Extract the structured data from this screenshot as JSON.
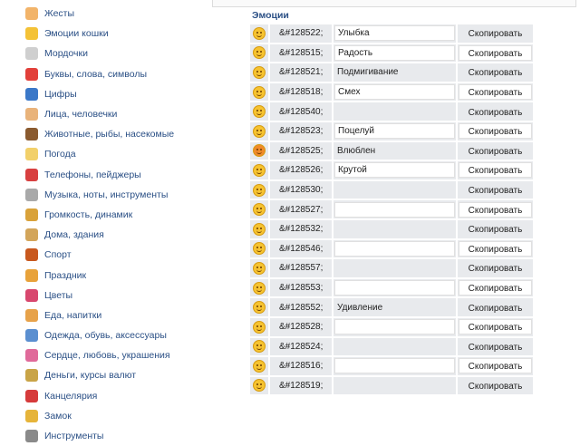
{
  "sidebar": {
    "items": [
      {
        "label": "Жесты",
        "icon": "thumbs-up-icon",
        "color": "#f2b46a"
      },
      {
        "label": "Эмоции кошки",
        "icon": "cat-face-icon",
        "color": "#f4c237"
      },
      {
        "label": "Мордочки",
        "icon": "animal-face-icon",
        "color": "#cfcfcf"
      },
      {
        "label": "Буквы, слова, символы",
        "icon": "letter-a-icon",
        "color": "#e2403a"
      },
      {
        "label": "Цифры",
        "icon": "digit-one-icon",
        "color": "#3b78c8"
      },
      {
        "label": "Лица, человечки",
        "icon": "person-face-icon",
        "color": "#e9b37a"
      },
      {
        "label": "Животные, рыбы, насекомые",
        "icon": "monkey-icon",
        "color": "#8a5a2f"
      },
      {
        "label": "Погода",
        "icon": "sun-cloud-icon",
        "color": "#f2d06a"
      },
      {
        "label": "Телефоны, пейджеры",
        "icon": "phone-icon",
        "color": "#d84040"
      },
      {
        "label": "Музыка, ноты, инструменты",
        "icon": "music-icon",
        "color": "#a9a9a9"
      },
      {
        "label": "Громкость, динамик",
        "icon": "speaker-icon",
        "color": "#d9a23a"
      },
      {
        "label": "Дома, здания",
        "icon": "building-icon",
        "color": "#d3a55a"
      },
      {
        "label": "Спорт",
        "icon": "basketball-icon",
        "color": "#c8581e"
      },
      {
        "label": "Праздник",
        "icon": "gift-icon",
        "color": "#e8a23a"
      },
      {
        "label": "Цветы",
        "icon": "flower-icon",
        "color": "#d8476e"
      },
      {
        "label": "Еда, напитки",
        "icon": "pizza-icon",
        "color": "#e7a24a"
      },
      {
        "label": "Одежда, обувь, аксессуары",
        "icon": "clothes-icon",
        "color": "#5b8fd0"
      },
      {
        "label": "Сердце, любовь, украшения",
        "icon": "heart-icon",
        "color": "#e06a9a"
      },
      {
        "label": "Деньги, курсы валют",
        "icon": "money-bag-icon",
        "color": "#c9a447"
      },
      {
        "label": "Канцелярия",
        "icon": "pushpin-icon",
        "color": "#d63b3b"
      },
      {
        "label": "Замок",
        "icon": "lock-icon",
        "color": "#e6b43a"
      },
      {
        "label": "Инструменты",
        "icon": "hammer-icon",
        "color": "#8a8a8a"
      }
    ]
  },
  "section": {
    "title": "Эмоции"
  },
  "copy_label": "Скопировать",
  "rows": [
    {
      "code": "&#128522;",
      "name": "Улыбка",
      "name_field": true,
      "copy_white": false
    },
    {
      "code": "&#128515;",
      "name": "Радость",
      "name_field": true,
      "copy_white": true
    },
    {
      "code": "&#128521;",
      "name": "Подмигивание",
      "name_field": false,
      "copy_white": false
    },
    {
      "code": "&#128518;",
      "name": "Смех",
      "name_field": true,
      "copy_white": true
    },
    {
      "code": "&#128540;",
      "name": "",
      "name_field": false,
      "copy_white": false
    },
    {
      "code": "&#128523;",
      "name": "Поцелуй",
      "name_field": true,
      "copy_white": true
    },
    {
      "code": "&#128525;",
      "name": "Влюблен",
      "name_field": false,
      "copy_white": false
    },
    {
      "code": "&#128526;",
      "name": "Крутой",
      "name_field": true,
      "copy_white": true
    },
    {
      "code": "&#128530;",
      "name": "",
      "name_field": false,
      "copy_white": false
    },
    {
      "code": "&#128527;",
      "name": "",
      "name_field": true,
      "copy_white": true
    },
    {
      "code": "&#128532;",
      "name": "",
      "name_field": false,
      "copy_white": false
    },
    {
      "code": "&#128546;",
      "name": "",
      "name_field": true,
      "copy_white": true
    },
    {
      "code": "&#128557;",
      "name": "",
      "name_field": false,
      "copy_white": false
    },
    {
      "code": "&#128553;",
      "name": "",
      "name_field": true,
      "copy_white": true
    },
    {
      "code": "&#128552;",
      "name": "Удивление",
      "name_field": false,
      "copy_white": false
    },
    {
      "code": "&#128528;",
      "name": "",
      "name_field": true,
      "copy_white": true
    },
    {
      "code": "&#128524;",
      "name": "",
      "name_field": false,
      "copy_white": false
    },
    {
      "code": "&#128516;",
      "name": "",
      "name_field": true,
      "copy_white": true
    },
    {
      "code": "&#128519;",
      "name": "",
      "name_field": false,
      "copy_white": false
    }
  ]
}
